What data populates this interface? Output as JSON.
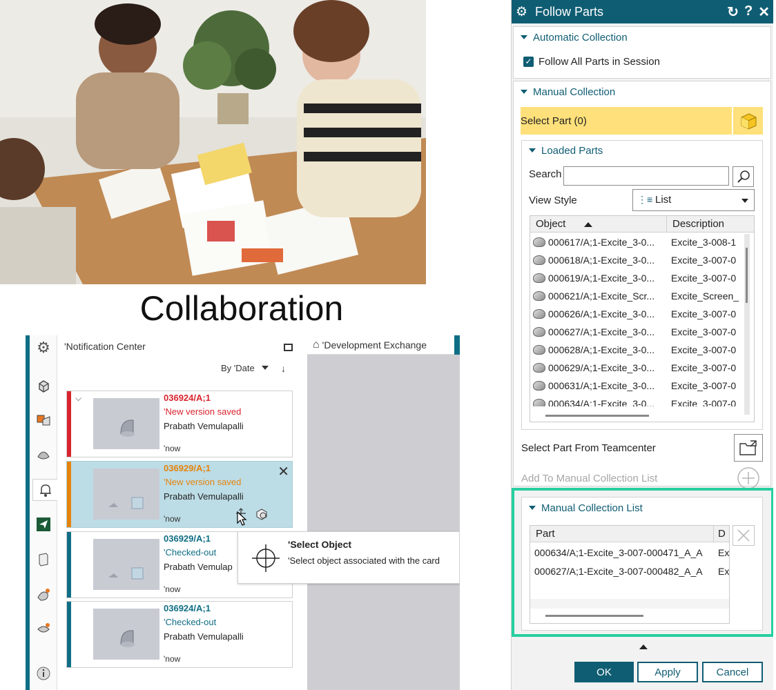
{
  "collab_title": "Collaboration",
  "notification_center": {
    "header": "'Notification Center",
    "sort_label": "By 'Date",
    "dev_exchange_tab": "'Development Exchange",
    "cards": [
      {
        "id": "036924/A;1",
        "status": "'New version saved",
        "user": "Prabath Vemulapalli",
        "time": "'now",
        "accent": "#d9232d",
        "status_color": "#d9232d"
      },
      {
        "id": "036929/A;1",
        "status": "'New version saved",
        "user": "Prabath Vemulapalli",
        "time": "'now",
        "accent": "#e5840d",
        "status_color": "#e5840d"
      },
      {
        "id": "036929/A;1",
        "status": "'Checked-out",
        "user": "Prabath Vemulap",
        "time": "'now",
        "accent": "#0f6e85",
        "status_color": "#0f6e85"
      },
      {
        "id": "036924/A;1",
        "status": "'Checked-out",
        "user": "Prabath Vemulapalli",
        "time": "'now",
        "accent": "#0f6e85",
        "status_color": "#0f6e85"
      }
    ],
    "tooltip": {
      "title": "'Select Object",
      "description": "'Select object associated with the card"
    }
  },
  "follow_parts": {
    "title": "Follow Parts",
    "automatic_collection": {
      "heading": "Automatic Collection",
      "follow_all_label": "Follow All Parts in Session",
      "follow_all_checked": true
    },
    "manual_collection": {
      "heading": "Manual Collection",
      "select_part_label": "Select Part (0)",
      "loaded_parts": {
        "heading": "Loaded Parts",
        "search_label": "Search",
        "search_value": "",
        "view_style_label": "View Style",
        "view_style_value": "List",
        "columns": [
          "Object",
          "Description"
        ],
        "rows": [
          {
            "object": "000617/A;1-Excite_3-0...",
            "description": "Excite_3-008-1"
          },
          {
            "object": "000618/A;1-Excite_3-0...",
            "description": "Excite_3-007-0"
          },
          {
            "object": "000619/A;1-Excite_3-0...",
            "description": "Excite_3-007-0"
          },
          {
            "object": "000621/A;1-Excite_Scr...",
            "description": "Excite_Screen_"
          },
          {
            "object": "000626/A;1-Excite_3-0...",
            "description": "Excite_3-007-0"
          },
          {
            "object": "000627/A;1-Excite_3-0...",
            "description": "Excite_3-007-0"
          },
          {
            "object": "000628/A;1-Excite_3-0...",
            "description": "Excite_3-007-0"
          },
          {
            "object": "000629/A;1-Excite_3-0...",
            "description": "Excite_3-007-0"
          },
          {
            "object": "000631/A;1-Excite_3-0...",
            "description": "Excite_3-007-0"
          },
          {
            "object": "000634/A;1-Excite_3-0...",
            "description": "Excite_3-007-0"
          }
        ]
      },
      "select_from_tc_label": "Select Part From Teamcenter",
      "add_to_list_label": "Add To Manual Collection List"
    },
    "manual_collection_list": {
      "heading": "Manual Collection List",
      "columns": [
        "Part",
        "D"
      ],
      "rows": [
        {
          "part": "000634/A;1-Excite_3-007-000471_A_A",
          "d": "Ex"
        },
        {
          "part": "000627/A;1-Excite_3-007-000482_A_A",
          "d": "Ex"
        }
      ]
    },
    "buttons": {
      "ok": "OK",
      "apply": "Apply",
      "cancel": "Cancel"
    },
    "accent_color": "#0f5d73",
    "highlight_color": "#27cfa0"
  }
}
